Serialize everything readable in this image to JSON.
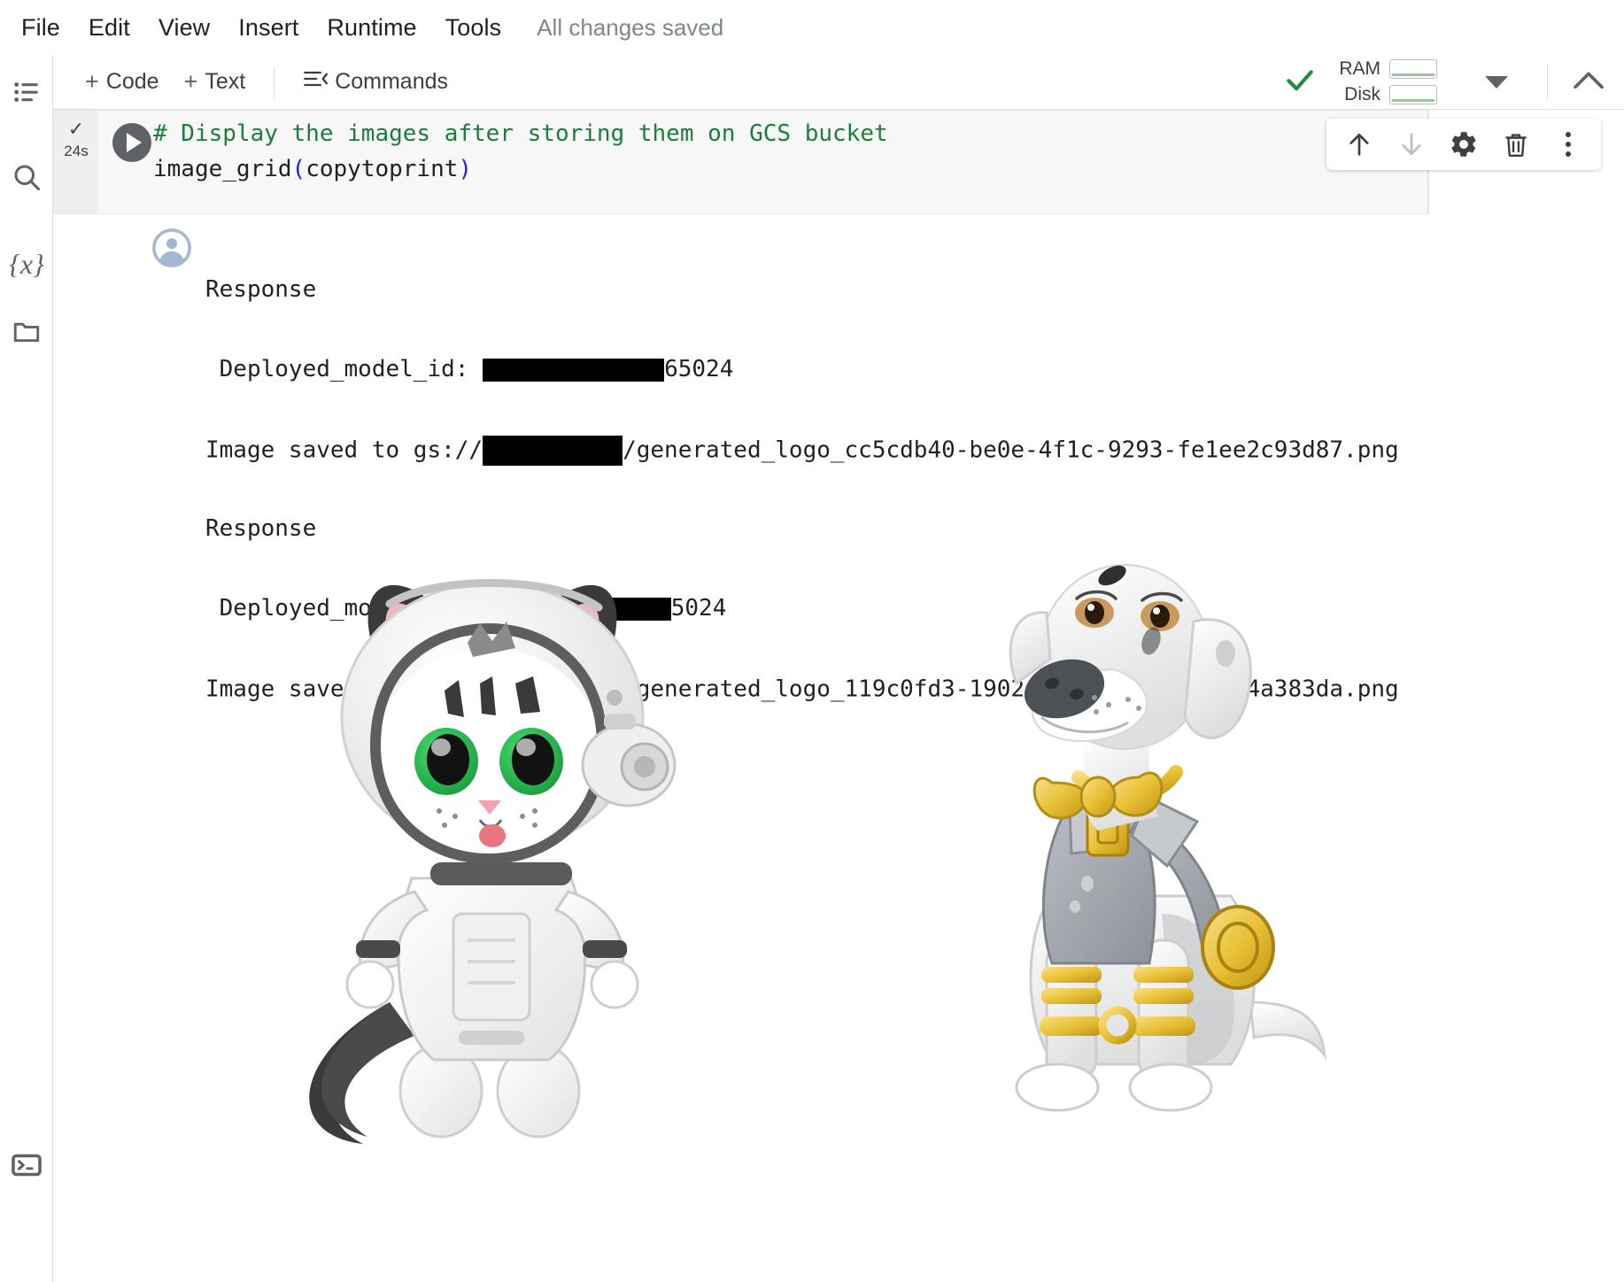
{
  "menubar": {
    "items": [
      {
        "label": "File"
      },
      {
        "label": "Edit"
      },
      {
        "label": "View"
      },
      {
        "label": "Insert"
      },
      {
        "label": "Runtime"
      },
      {
        "label": "Tools"
      }
    ],
    "save_status": "All changes saved"
  },
  "rail": {
    "items": [
      {
        "name": "table-of-contents",
        "label": "Table of contents"
      },
      {
        "name": "search",
        "label": "Search"
      },
      {
        "name": "variables",
        "label": "{x}"
      },
      {
        "name": "files",
        "label": "Files"
      },
      {
        "name": "terminal",
        "label": "Terminal"
      }
    ]
  },
  "toolbar": {
    "add_code_label": "Code",
    "add_text_label": "Text",
    "commands_label": "Commands",
    "plus": "+",
    "ram_label": "RAM",
    "disk_label": "Disk",
    "connected_color": "#1e8e3e"
  },
  "cell": {
    "status_check": "✓",
    "exec_time": "24s",
    "code_comment": "# Display the images after storing them on GCS bucket",
    "code_call_name": "image_grid",
    "code_open_paren": "(",
    "code_arg": "copytoprint",
    "code_close_paren": ")",
    "tools": [
      {
        "name": "move-cell-up",
        "glyph": "↑"
      },
      {
        "name": "move-cell-down",
        "glyph": "↓"
      },
      {
        "name": "cell-settings",
        "glyph": "gear"
      },
      {
        "name": "delete-cell",
        "glyph": "trash"
      },
      {
        "name": "more-cell-actions",
        "glyph": "dots"
      }
    ]
  },
  "output": {
    "lines": [
      {
        "type": "text",
        "text": "Response"
      },
      {
        "type": "redacted",
        "prefix": " Deployed_model_id: ",
        "suffix": "65024",
        "redact_class": "r1"
      },
      {
        "type": "redacted",
        "prefix": "Image saved to gs://",
        "suffix": "/generated_logo_cc5cdb40-be0e-4f1c-9293-fe1ee2c93d87.png",
        "redact_class": "r2"
      },
      {
        "type": "text",
        "text": "Response"
      },
      {
        "type": "redacted",
        "prefix": " Deployed_model_id: 1",
        "suffix": "5024",
        "redact_class": "r3"
      },
      {
        "type": "redacted",
        "prefix": "Image saved to gs://",
        "suffix": "/generated_logo_119c0fd3-1902-44e4-ab9c-931e44a383da.png",
        "redact_class": "r4"
      }
    ],
    "images": [
      {
        "name": "astronaut-cat-logo",
        "alt": "3D cartoon white cat in astronaut helmet and space suit with green eyes"
      },
      {
        "name": "golden-bowtie-dog-logo",
        "alt": "3D cartoon white dalmatian dog with yellow bow tie and gold bracelets"
      }
    ]
  },
  "colors": {
    "comment_green": "#1a7f37",
    "paren_blue": "#1a1aff",
    "cat_eye_green": "#22b24a",
    "dog_gold": "#efc game"
  }
}
